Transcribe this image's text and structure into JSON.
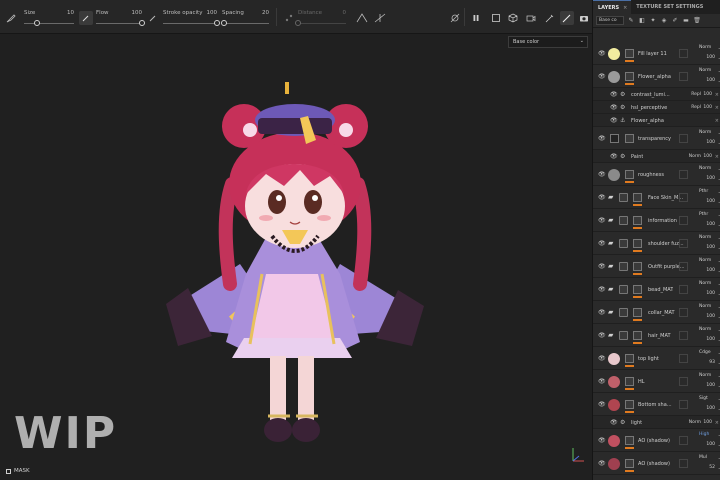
{
  "toolbar": {
    "size_label": "Size",
    "size_value": "10",
    "size_level": 0.25,
    "flow_label": "Flow",
    "flow_value": "100",
    "flow_level": 1.0,
    "stroke_opacity_label": "Stroke opacity",
    "stroke_opacity_value": "100",
    "stroke_opacity_level": 1.0,
    "spacing_label": "Spacing",
    "spacing_value": "20",
    "spacing_level": 0.05,
    "distance_label": "Distance",
    "distance_value": "0",
    "distance_level": 0.0
  },
  "viewport": {
    "channel_select": "Base color",
    "watermark": "WIP",
    "mask_label": "MASK"
  },
  "panel": {
    "tabs": [
      {
        "label": "LAYERS",
        "close": "×"
      },
      {
        "label": "TEXTURE SET SETTINGS",
        "close": ""
      }
    ],
    "texture_set": "Base co",
    "layers": [
      {
        "name": "Fill layer 11",
        "blend": "Norm",
        "opacity": "100",
        "thumb": "#f2eca0",
        "kind": "fill"
      },
      {
        "name": "Flower_alpha",
        "blend": "Norm",
        "opacity": "100",
        "thumb": "#9a9a9a",
        "kind": "fill"
      },
      {
        "name": "contrast_lumi...",
        "blend": "Repl",
        "opacity": "100",
        "kind": "sub"
      },
      {
        "name": "hsl_perceptive",
        "blend": "Repl",
        "opacity": "100",
        "kind": "sub"
      },
      {
        "name": "Flower_alpha",
        "blend": "",
        "opacity": "",
        "kind": "anchor"
      },
      {
        "name": "transparency",
        "blend": "Norm",
        "opacity": "100",
        "kind": "paint"
      },
      {
        "name": "Paint",
        "blend": "Norm",
        "opacity": "100",
        "kind": "sub"
      },
      {
        "name": "roughness",
        "blend": "Norm",
        "opacity": "100",
        "thumb": "#8a8a8a",
        "kind": "fill"
      },
      {
        "name": "Face Skin_M...",
        "blend": "Pthr",
        "opacity": "100",
        "kind": "folder"
      },
      {
        "name": "information",
        "blend": "Pthr",
        "opacity": "100",
        "kind": "folder"
      },
      {
        "name": "shoulder fuz...",
        "blend": "Norm",
        "opacity": "100",
        "kind": "folder"
      },
      {
        "name": "Outfit purple...",
        "blend": "Norm",
        "opacity": "100",
        "kind": "folder"
      },
      {
        "name": "bead_MAT",
        "blend": "Norm",
        "opacity": "100",
        "kind": "folder"
      },
      {
        "name": "collar_MAT",
        "blend": "Norm",
        "opacity": "100",
        "kind": "folder"
      },
      {
        "name": "hair_MAT",
        "blend": "Norm",
        "opacity": "100",
        "kind": "folder"
      },
      {
        "name": "top light",
        "blend": "Cdge",
        "opacity": "93",
        "thumb": "#e8c8cc",
        "kind": "fill"
      },
      {
        "name": "HL",
        "blend": "Norm",
        "opacity": "100",
        "thumb": "#c0606a",
        "kind": "fill"
      },
      {
        "name": "Bottom sha...",
        "blend": "Sigt",
        "opacity": "100",
        "thumb": "#b04550",
        "kind": "fill"
      },
      {
        "name": "light",
        "blend": "Norm",
        "opacity": "100",
        "kind": "sub"
      },
      {
        "name": "AO (shadow)",
        "blend": "High",
        "opacity": "100",
        "thumb": "#c05060",
        "kind": "fill",
        "blue": true
      },
      {
        "name": "AO (shadow)",
        "blend": "Mul",
        "opacity": "52",
        "thumb": "#a04050",
        "kind": "fill"
      }
    ]
  }
}
